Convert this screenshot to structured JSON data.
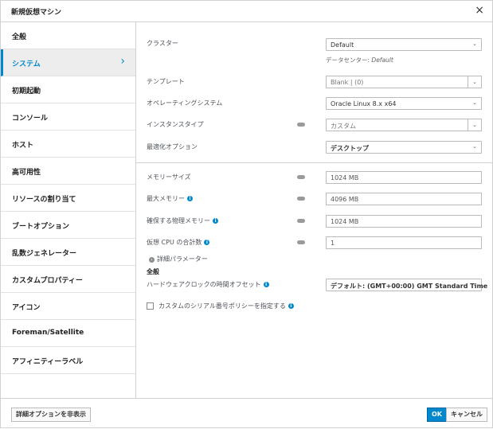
{
  "dialog": {
    "title": "新規仮想マシン",
    "close_glyph": "×"
  },
  "sidebar": {
    "items": [
      {
        "label": "全般"
      },
      {
        "label": "システム"
      },
      {
        "label": "初期起動"
      },
      {
        "label": "コンソール"
      },
      {
        "label": "ホスト"
      },
      {
        "label": "高可用性"
      },
      {
        "label": "リソースの割り当て"
      },
      {
        "label": "ブートオプション"
      },
      {
        "label": "乱数ジェネレーター"
      },
      {
        "label": "カスタムプロパティー"
      },
      {
        "label": "アイコン"
      },
      {
        "label": "Foreman/Satellite"
      },
      {
        "label": "アフィニティーラベル"
      }
    ],
    "active_index": 1
  },
  "form": {
    "cluster_label": "クラスター",
    "cluster_value": "Default",
    "datacenter_prefix": "データセンター: ",
    "datacenter_value": "Default",
    "template_label": "テンプレート",
    "template_value": "Blank | (0)",
    "os_label": "オペレーティングシステム",
    "os_value": "Oracle Linux 8.x x64",
    "instance_type_label": "インスタンスタイプ",
    "instance_type_value": "カスタム",
    "optimization_label": "最適化オプション",
    "optimization_value": "デスクトップ",
    "memory_label": "メモリーサイズ",
    "memory_value": "1024 MB",
    "max_memory_label": "最大メモリー",
    "max_memory_value": "4096 MB",
    "guaranteed_memory_label": "確保する物理メモリー",
    "guaranteed_memory_value": "1024 MB",
    "vcpu_label": "仮想 CPU の合計数",
    "vcpu_value": "1",
    "advanced_params_label": "詳細パラメーター",
    "general_heading": "全般",
    "hw_clock_label": "ハードウェアクロックの時間オフセット",
    "hw_clock_value": "デフォルト: (GMT+00:00) GMT Standard Time",
    "serial_policy_label": "カスタムのシリアル番号ポリシーを指定する"
  },
  "footer": {
    "hide_advanced_label": "詳細オプションを非表示",
    "ok_label": "OK",
    "cancel_label": "キャンセル"
  },
  "colors": {
    "accent": "#0088ce",
    "active_bg": "#ededed",
    "border": "#d1d1d1"
  },
  "icons": {
    "close": "close-icon",
    "chevron": "chevron-right-icon",
    "dropdown": "chevron-down-icon",
    "info": "info-icon",
    "pin": "pin-icon",
    "expand": "expand-icon"
  }
}
